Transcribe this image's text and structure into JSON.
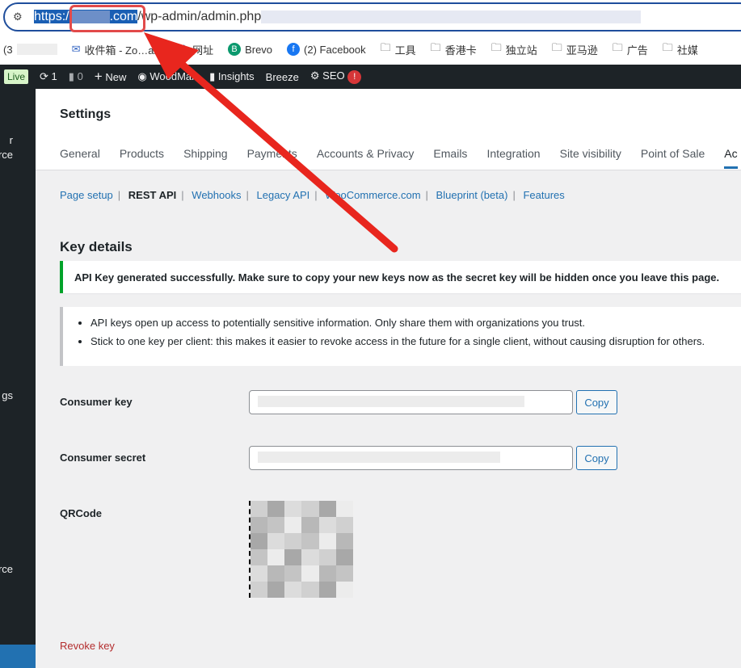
{
  "browser": {
    "url_scheme": "https:/",
    "url_domain_suffix": ".com",
    "url_path": "wp-admin/admin.php",
    "bookmarks": [
      "(3",
      "收件箱 - Zo…ai...",
      "网址",
      "Brevo",
      "(2) Facebook",
      "工具",
      "香港卡",
      "独立站",
      "亚马逊",
      "广告",
      "社媒"
    ]
  },
  "adminbar": {
    "live": "Live",
    "updates": "1",
    "comments": "0",
    "new": "New",
    "woodmart": "WoodMart",
    "insights": "Insights",
    "breeze": "Breeze",
    "seo": "SEO",
    "seo_badge": "!"
  },
  "sidebar": {
    "items": [
      "r",
      "rce",
      "gs",
      "rce"
    ]
  },
  "header": {
    "title": "Settings",
    "tabs": [
      "General",
      "Products",
      "Shipping",
      "Payments",
      "Accounts & Privacy",
      "Emails",
      "Integration",
      "Site visibility",
      "Point of Sale",
      "Ac"
    ]
  },
  "subnav": {
    "items": [
      "Page setup",
      "REST API",
      "Webhooks",
      "Legacy API",
      "WooCommerce.com",
      "Blueprint (beta)",
      "Features"
    ],
    "separator": "|"
  },
  "main": {
    "heading": "Key details",
    "notice": "API Key generated successfully. Make sure to copy your new keys now as the secret key will be hidden once you leave this page.",
    "info": [
      "API keys open up access to potentially sensitive information. Only share them with organizations you trust.",
      "Stick to one key per client: this makes it easier to revoke access in the future for a single client, without causing disruption for others."
    ],
    "consumer_key_label": "Consumer key",
    "consumer_secret_label": "Consumer secret",
    "copy": "Copy",
    "qrcode_label": "QRCode",
    "revoke": "Revoke key"
  },
  "colors": {
    "accent": "#2271b1",
    "annotation": "#e8261e",
    "success": "#00a32a"
  }
}
